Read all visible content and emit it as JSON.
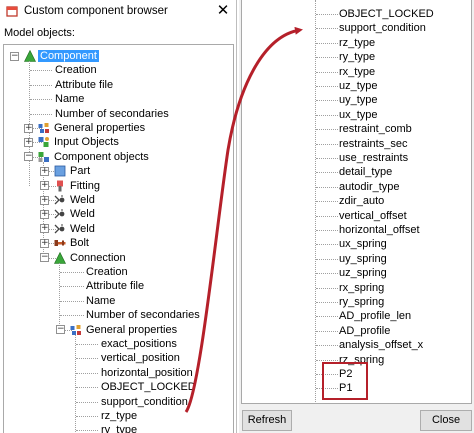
{
  "window": {
    "title": "Custom component browser",
    "close_glyph": "✕"
  },
  "left": {
    "section_label": "Model objects:",
    "root_label": "Component",
    "component_children": [
      "Creation",
      "Attribute file",
      "Name",
      "Number of secondaries"
    ],
    "general_properties": "General properties",
    "input_objects": "Input Objects",
    "component_objects": "Component objects",
    "objects": [
      "Part",
      "Fitting",
      "Weld",
      "Weld",
      "Weld",
      "Bolt"
    ],
    "connection_label": "Connection",
    "connection_children": [
      "Creation",
      "Attribute file",
      "Name",
      "Number of secondaries"
    ],
    "conn_general_properties": "General properties",
    "property_items": [
      "exact_positions",
      "vertical_position",
      "horizontal_position",
      "OBJECT_LOCKED",
      "support_condition",
      "rz_type",
      "ry_type"
    ]
  },
  "right": {
    "items": [
      "OBJECT_LOCKED",
      "support_condition",
      "rz_type",
      "ry_type",
      "rx_type",
      "uz_type",
      "uy_type",
      "ux_type",
      "restraint_comb",
      "restraints_sec",
      "use_restraints",
      "detail_type",
      "autodir_type",
      "zdir_auto",
      "vertical_offset",
      "horizontal_offset",
      "ux_spring",
      "uy_spring",
      "uz_spring",
      "rx_spring",
      "ry_spring",
      "AD_profile_len",
      "AD_profile",
      "analysis_offset_x",
      "rz_spring",
      "P2",
      "P1"
    ],
    "refresh_label": "Refresh",
    "close_label": "Close"
  },
  "colors": {
    "selection": "#3399ff",
    "annotation": "#b5202a"
  }
}
